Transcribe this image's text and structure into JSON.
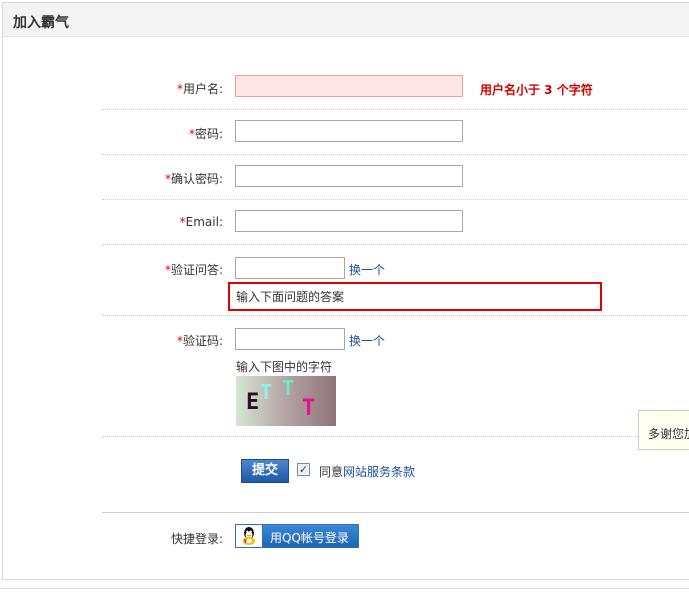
{
  "header": {
    "title": "加入霸气"
  },
  "form": {
    "required_mark": "*",
    "username": {
      "label": "用户名:",
      "value": "",
      "error": "用户名小于 3 个字符"
    },
    "password": {
      "label": "密码:",
      "value": ""
    },
    "confirm_password": {
      "label": "确认密码:",
      "value": ""
    },
    "email": {
      "label": "Email:",
      "value": ""
    },
    "security_question": {
      "label": "验证问答:",
      "value": "",
      "change_link": "换一个",
      "hint": "输入下面问题的答案"
    },
    "captcha": {
      "label": "验证码:",
      "value": "",
      "change_link": "换一个",
      "hint": "输入下图中的字符",
      "chars": [
        "E",
        "T",
        "T",
        "T"
      ]
    },
    "submit": {
      "label": "提交"
    },
    "agree": {
      "checked": true,
      "check_glyph": "✓",
      "prefix": "同意",
      "link": "网站服务条款"
    },
    "quick_login": {
      "label": "快捷登录:",
      "button": "用QQ帐号登录"
    }
  },
  "tooltip": {
    "text": "多谢您加"
  },
  "colors": {
    "error": "#d60000",
    "link": "#1a4f9c",
    "button": "#1f5aa8",
    "highlight": "#e00000"
  }
}
